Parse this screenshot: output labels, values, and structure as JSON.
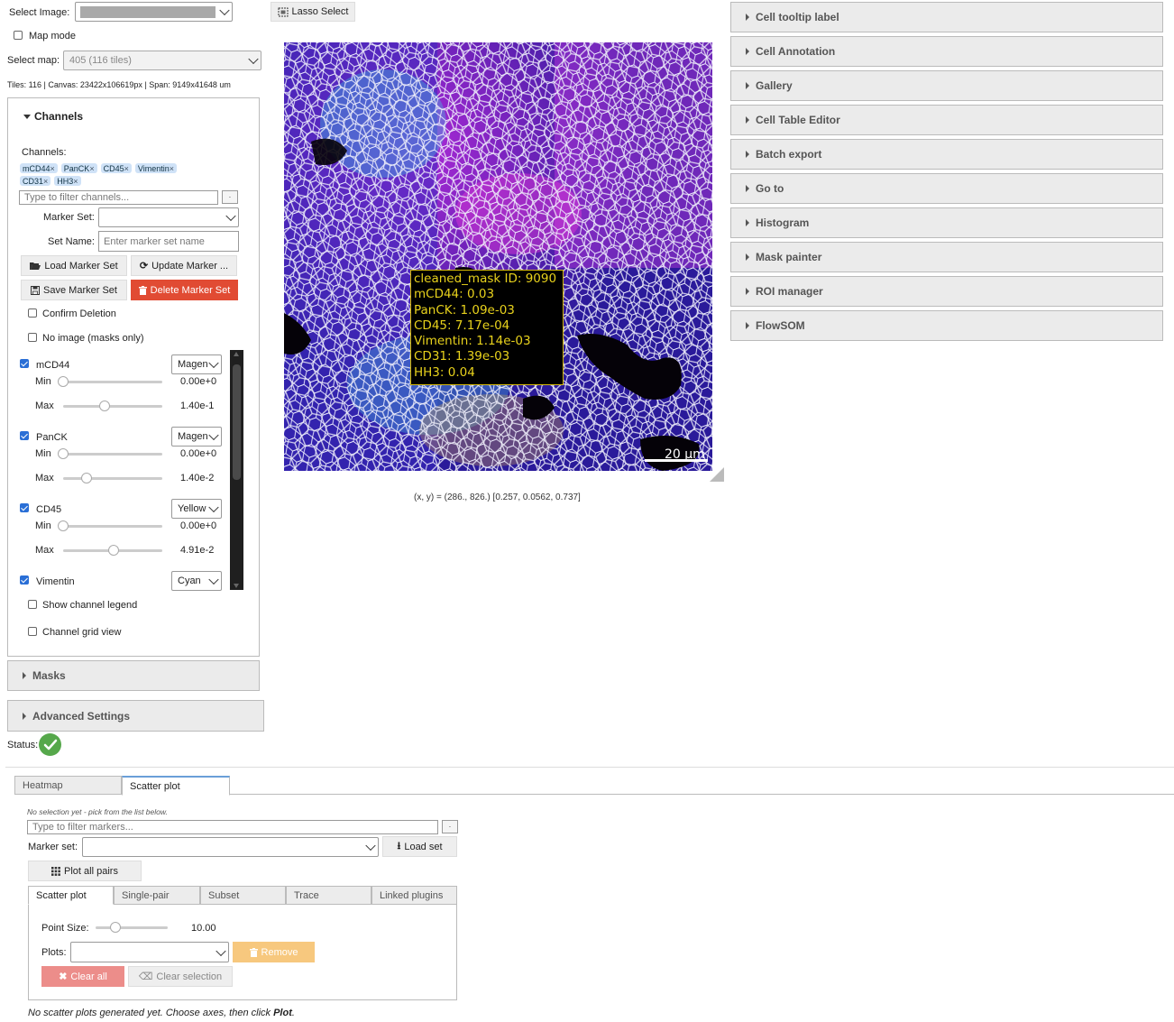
{
  "top": {
    "select_image_label": "Select Image:",
    "map_mode_label": "Map mode",
    "select_map_label": "Select map:",
    "select_map_value": "405 (116 tiles)",
    "tiles_info": "Tiles: 116 | Canvas: 23422x106619px | Span: 9149x41648 um",
    "lasso_label": "Lasso Select"
  },
  "channels_panel": {
    "title": "Channels",
    "channels_label": "Channels:",
    "tags": [
      "mCD44",
      "PanCK",
      "CD45",
      "Vimentin",
      "CD31",
      "HH3"
    ],
    "filter_placeholder": "Type to filter channels...",
    "marker_set_label": "Marker Set:",
    "set_name_label": "Set Name:",
    "set_name_placeholder": "Enter marker set name",
    "load_btn": "Load Marker Set",
    "update_btn": "Update Marker ...",
    "save_btn": "Save Marker Set",
    "delete_btn": "Delete Marker Set",
    "confirm_label": "Confirm Deletion",
    "no_image_label": "No image (masks only)",
    "channels": [
      {
        "name": "mCD44",
        "color": "Magen",
        "min_label": "Min",
        "max_label": "Max",
        "min_val": "0.00e+0",
        "max_val": "1.40e-1",
        "min_frac": 0.0,
        "max_frac": 0.42
      },
      {
        "name": "PanCK",
        "color": "Magen",
        "min_label": "Min",
        "max_label": "Max",
        "min_val": "0.00e+0",
        "max_val": "1.40e-2",
        "min_frac": 0.0,
        "max_frac": 0.24
      },
      {
        "name": "CD45",
        "color": "Yellow",
        "min_label": "Min",
        "max_label": "Max",
        "min_val": "0.00e+0",
        "max_val": "4.91e-2",
        "min_frac": 0.0,
        "max_frac": 0.51
      },
      {
        "name": "Vimentin",
        "color": "Cyan"
      }
    ],
    "legend_label": "Show channel legend",
    "grid_label": "Channel grid view"
  },
  "masks_title": "Masks",
  "advanced_title": "Advanced Settings",
  "status_label": "Status:",
  "tooltip": {
    "lines": [
      "cleaned_mask ID: 9090",
      "mCD44: 0.03",
      "PanCK: 1.09e-03",
      "CD45: 7.17e-04",
      "Vimentin: 1.14e-03",
      "CD31: 1.39e-03",
      "HH3: 0.04"
    ]
  },
  "scale_bar": "20 µm",
  "coord_readout": "(x, y) = (286., 826.) [0.257, 0.0562, 0.737]",
  "right_panels": [
    "Cell tooltip label",
    "Cell Annotation",
    "Gallery",
    "Cell Table Editor",
    "Batch export",
    "Go to",
    "Histogram",
    "Mask painter",
    "ROI manager",
    "FlowSOM"
  ],
  "bottom": {
    "tabs": [
      "Heatmap",
      "Scatter plot"
    ],
    "no_selection": "No selection yet - pick from the list below.",
    "filter_placeholder": "Type to filter markers...",
    "marker_set_label": "Marker set:",
    "load_set": "Load set",
    "plot_all": "Plot all pairs",
    "subtabs": [
      "Scatter plot",
      "Single-pair",
      "Subset",
      "Trace",
      "Linked plugins"
    ],
    "point_size_label": "Point Size:",
    "point_size_value": "10.00",
    "point_size_frac": 0.2,
    "plots_label": "Plots:",
    "remove_btn": "Remove",
    "clear_all_btn": "Clear all",
    "clear_sel_btn": "Clear selection",
    "footer_prefix": "No scatter plots generated yet. Choose axes, then click ",
    "footer_bold": "Plot",
    "footer_suffix": "."
  }
}
